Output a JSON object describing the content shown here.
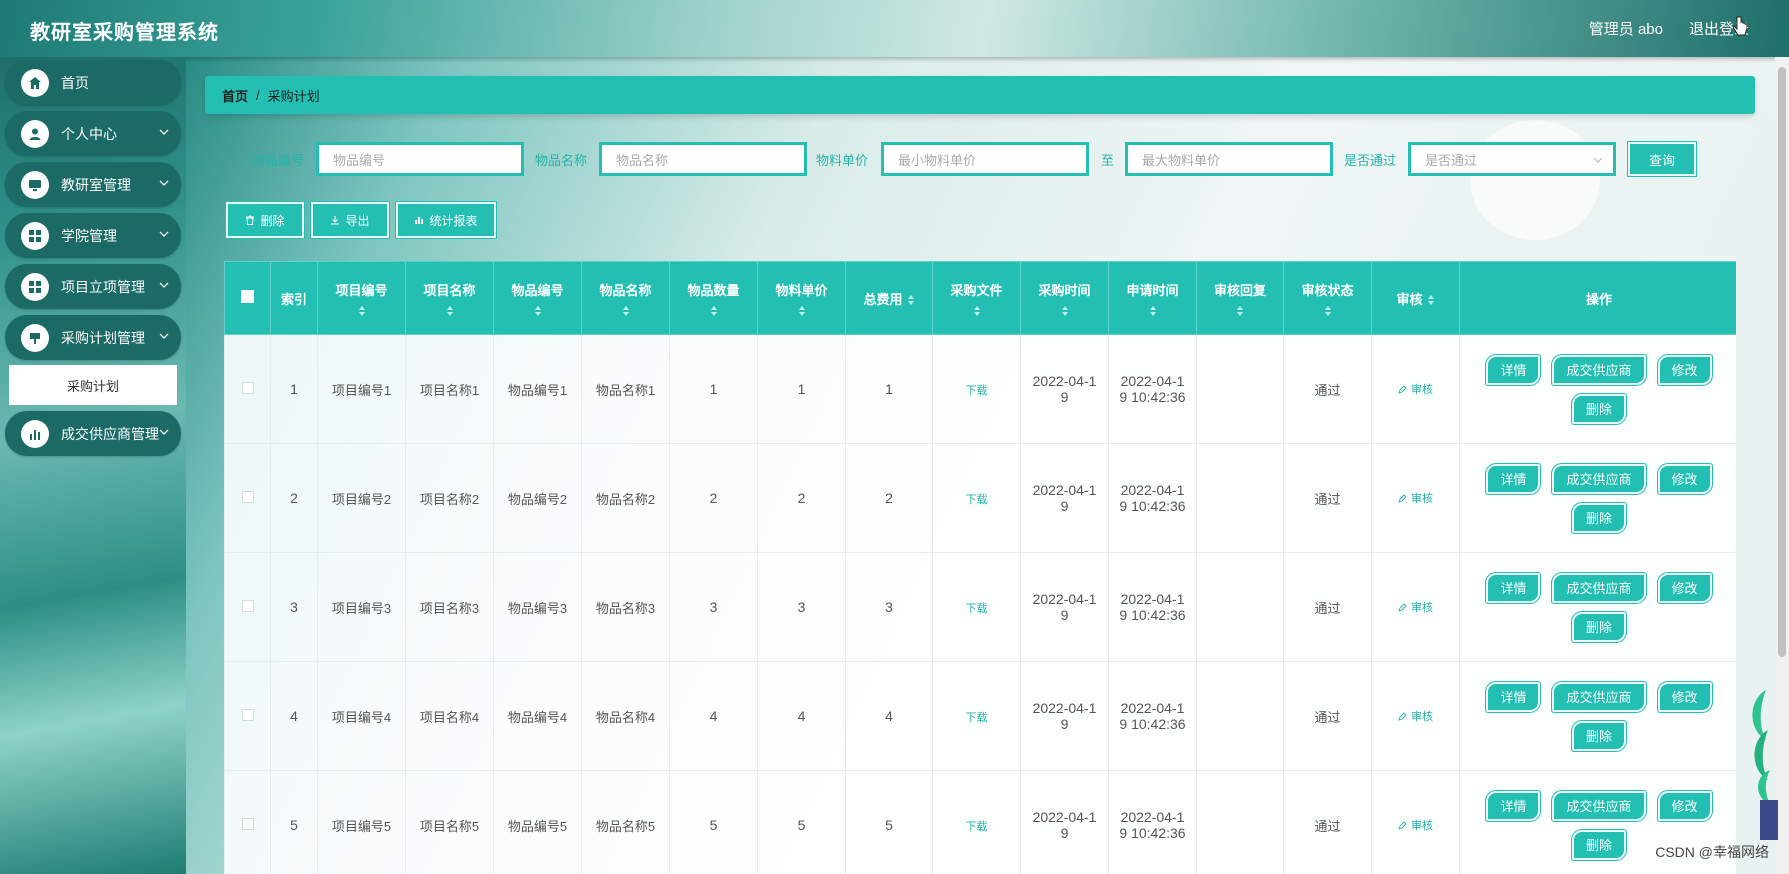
{
  "header": {
    "title": "教研室采购管理系统",
    "user_label": "管理员 abo",
    "logout": "退出登录"
  },
  "sidebar": {
    "items": [
      {
        "label": "首页",
        "icon": "home-icon"
      },
      {
        "label": "个人中心",
        "icon": "user-icon"
      },
      {
        "label": "教研室管理",
        "icon": "monitor-icon"
      },
      {
        "label": "学院管理",
        "icon": "grid-icon"
      },
      {
        "label": "项目立项管理",
        "icon": "grid-icon"
      },
      {
        "label": "采购计划管理",
        "icon": "flag-icon"
      },
      {
        "label": "成交供应商管理",
        "icon": "bar-chart-icon"
      }
    ],
    "submenu": {
      "label": "采购计划"
    }
  },
  "breadcrumb": {
    "home": "首页",
    "separator": "/",
    "current": "采购计划"
  },
  "search": {
    "item_no_label": "物品编号",
    "item_no_placeholder": "物品编号",
    "item_name_label": "物品名称",
    "item_name_placeholder": "物品名称",
    "price_label": "物料单价",
    "price_min_placeholder": "最小物料单价",
    "to_label": "至",
    "price_max_placeholder": "最大物料单价",
    "passed_label": "是否通过",
    "passed_placeholder": "是否通过",
    "query_button": "查询"
  },
  "actions": {
    "delete": "删除",
    "export": "导出",
    "report": "统计报表"
  },
  "table": {
    "headers": [
      "索引",
      "项目编号",
      "项目名称",
      "物品编号",
      "物品名称",
      "物品数量",
      "物料单价",
      "总费用",
      "采购文件",
      "采购时间",
      "申请时间",
      "审核回复",
      "审核状态",
      "审核",
      "操作"
    ],
    "rows": [
      {
        "index": "1",
        "project_no": "项目编号1",
        "project_name": "项目名称1",
        "item_no": "物品编号1",
        "item_name": "物品名称1",
        "qty": "1",
        "price": "1",
        "total": "1",
        "file": "下载",
        "purchase_time_1": "2022-04-1",
        "purchase_time_2": "9",
        "apply_time_1": "2022-04-1",
        "apply_time_2": "9 10:42:36",
        "reply": "",
        "status": "通过",
        "audit": "审核"
      },
      {
        "index": "2",
        "project_no": "项目编号2",
        "project_name": "项目名称2",
        "item_no": "物品编号2",
        "item_name": "物品名称2",
        "qty": "2",
        "price": "2",
        "total": "2",
        "file": "下载",
        "purchase_time_1": "2022-04-1",
        "purchase_time_2": "9",
        "apply_time_1": "2022-04-1",
        "apply_time_2": "9 10:42:36",
        "reply": "",
        "status": "通过",
        "audit": "审核"
      },
      {
        "index": "3",
        "project_no": "项目编号3",
        "project_name": "项目名称3",
        "item_no": "物品编号3",
        "item_name": "物品名称3",
        "qty": "3",
        "price": "3",
        "total": "3",
        "file": "下载",
        "purchase_time_1": "2022-04-1",
        "purchase_time_2": "9",
        "apply_time_1": "2022-04-1",
        "apply_time_2": "9 10:42:36",
        "reply": "",
        "status": "通过",
        "audit": "审核"
      },
      {
        "index": "4",
        "project_no": "项目编号4",
        "project_name": "项目名称4",
        "item_no": "物品编号4",
        "item_name": "物品名称4",
        "qty": "4",
        "price": "4",
        "total": "4",
        "file": "下载",
        "purchase_time_1": "2022-04-1",
        "purchase_time_2": "9",
        "apply_time_1": "2022-04-1",
        "apply_time_2": "9 10:42:36",
        "reply": "",
        "status": "通过",
        "audit": "审核"
      },
      {
        "index": "5",
        "project_no": "项目编号5",
        "project_name": "项目名称5",
        "item_no": "物品编号5",
        "item_name": "物品名称5",
        "qty": "5",
        "price": "5",
        "total": "5",
        "file": "下载",
        "purchase_time_1": "2022-04-1",
        "purchase_time_2": "9",
        "apply_time_1": "2022-04-1",
        "apply_time_2": "9 10:42:36",
        "reply": "",
        "status": "通过",
        "audit": "审核"
      }
    ],
    "row_ops": {
      "detail": "详情",
      "supplier": "成交供应商",
      "edit": "修改",
      "delete": "删除"
    }
  },
  "watermark": "CSDN @幸福网络",
  "colors": {
    "accent": "#23bfb3",
    "sidebar_item": "#1b6a66",
    "link": "#25b3a8"
  }
}
